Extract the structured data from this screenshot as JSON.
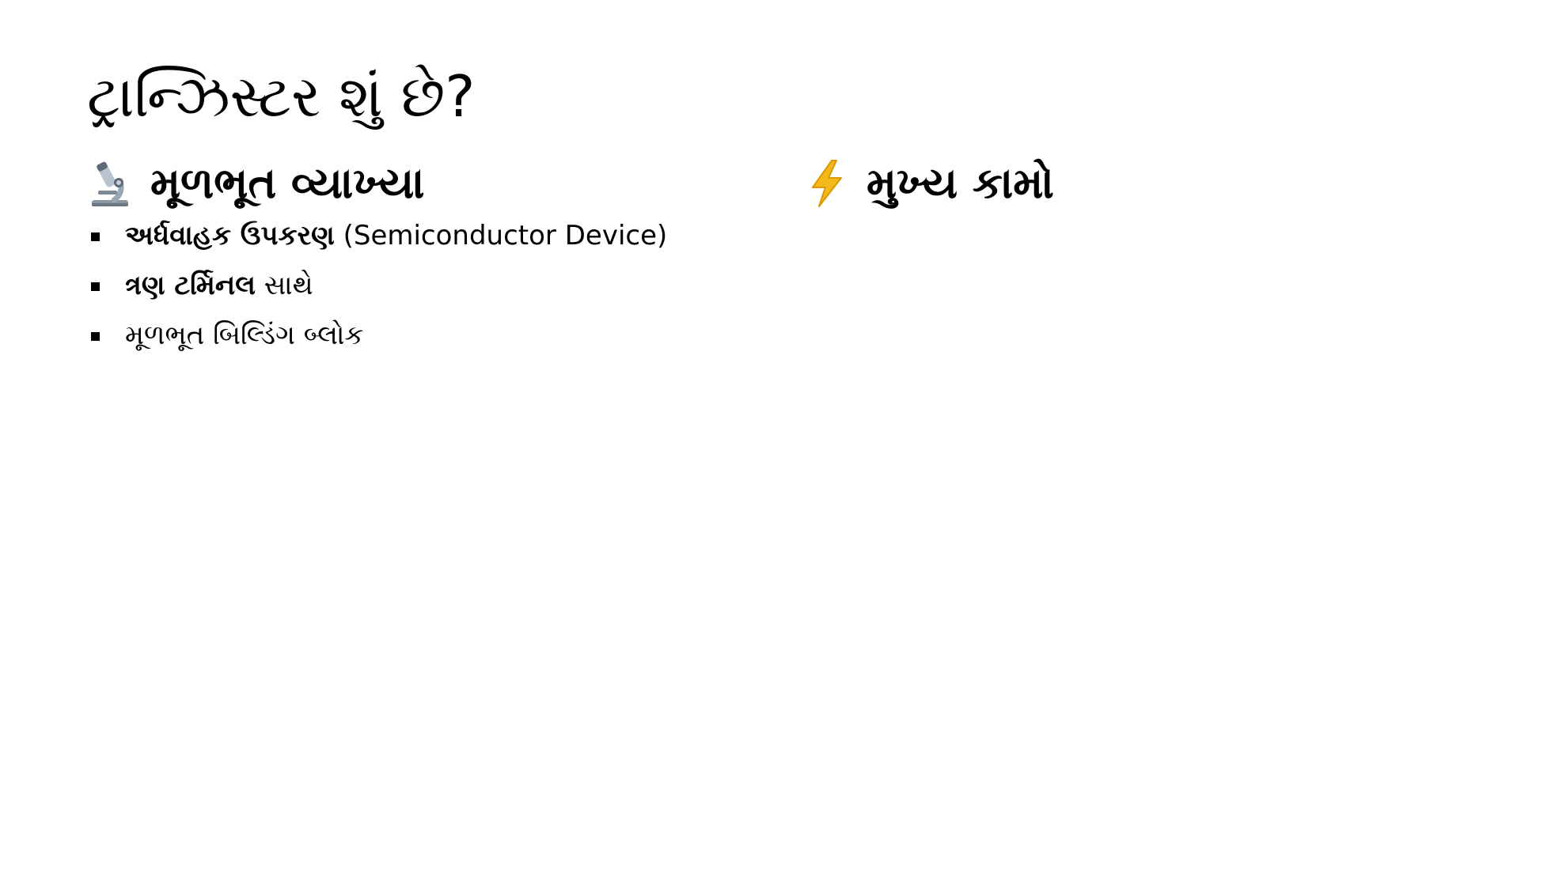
{
  "slide": {
    "title": "ટ્રાન્ઝિસ્ટર શું છે?",
    "left_column": {
      "icon": "microscope-icon",
      "heading": "મૂળભૂત વ્યાખ્યા",
      "items": [
        {
          "bold": "અર્ધવાહક ઉપકરણ",
          "text": " (Semiconductor Device)"
        },
        {
          "bold": "ત્રણ ટર્મિનલ",
          "text": " સાથે"
        },
        {
          "bold": "",
          "text": "મૂળભૂત બિલ્ડિંગ બ્લોક"
        }
      ]
    },
    "right_column": {
      "icon": "lightning-icon",
      "heading": "મુખ્ય કામો"
    }
  },
  "colors": {
    "background": "#ffffff",
    "text": "#000000",
    "lightning": "#f5b81c"
  }
}
